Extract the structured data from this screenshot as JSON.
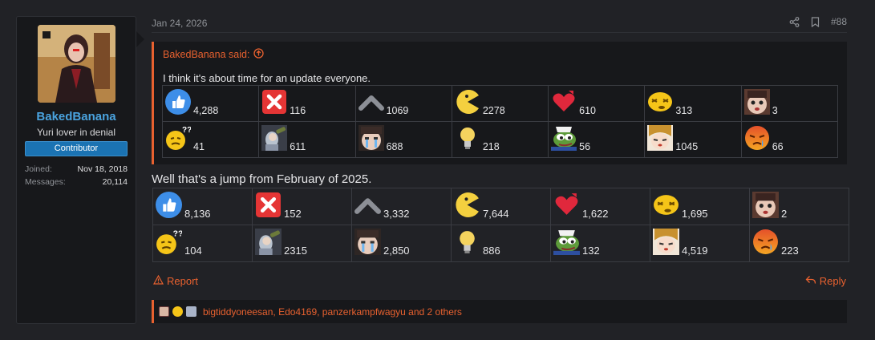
{
  "user": {
    "name": "BakedBanana",
    "title": "Yuri lover in denial",
    "banner": "Contributor",
    "joined_label": "Joined:",
    "joined_value": "Nov 18, 2018",
    "messages_label": "Messages:",
    "messages_value": "20,114"
  },
  "post": {
    "date": "Jan 24, 2026",
    "number": "#88",
    "quote_author": "BakedBanana said:",
    "quote_text": "I think it's about time for an update everyone.",
    "body": "Well that's a jump from February of 2025.",
    "report": "Report",
    "reply": "Reply",
    "likes_text": "bigtiddyoneesan, Edo4169, panzerkampfwagyu and 2 others"
  },
  "quote_reactions": [
    [
      {
        "icon": "like-icon",
        "count": "4,288"
      },
      {
        "icon": "red-x-icon",
        "count": "116"
      },
      {
        "icon": "chevron-up-icon",
        "count": "1069"
      },
      {
        "icon": "pacman-icon",
        "count": "2278"
      },
      {
        "icon": "heart-icon",
        "count": "610"
      },
      {
        "icon": "dizzy-face-icon",
        "count": "313"
      },
      {
        "icon": "anime-face-icon",
        "count": "3"
      }
    ],
    [
      {
        "icon": "confused-face-icon",
        "count": "41"
      },
      {
        "icon": "anime-telescope-icon",
        "count": "611"
      },
      {
        "icon": "anime-crying-icon",
        "count": "688"
      },
      {
        "icon": "lightbulb-icon",
        "count": "218"
      },
      {
        "icon": "pepe-icon",
        "count": "56"
      },
      {
        "icon": "anime-girl-icon",
        "count": "1045"
      },
      {
        "icon": "angry-crying-face-icon",
        "count": "66"
      }
    ]
  ],
  "body_reactions": [
    [
      {
        "icon": "like-icon",
        "count": "8,136"
      },
      {
        "icon": "red-x-icon",
        "count": "152"
      },
      {
        "icon": "chevron-up-icon",
        "count": "3,332"
      },
      {
        "icon": "pacman-icon",
        "count": "7,644"
      },
      {
        "icon": "heart-icon",
        "count": "1,622"
      },
      {
        "icon": "dizzy-face-icon",
        "count": "1,695"
      },
      {
        "icon": "anime-face-icon",
        "count": "2"
      }
    ],
    [
      {
        "icon": "confused-face-icon",
        "count": "104"
      },
      {
        "icon": "anime-telescope-icon",
        "count": "2315"
      },
      {
        "icon": "anime-crying-icon",
        "count": "2,850"
      },
      {
        "icon": "lightbulb-icon",
        "count": "886"
      },
      {
        "icon": "pepe-icon",
        "count": "132"
      },
      {
        "icon": "anime-girl-icon",
        "count": "4,519"
      },
      {
        "icon": "angry-crying-face-icon",
        "count": "223"
      }
    ]
  ],
  "colors": {
    "accent": "#e8612f",
    "username": "#4aa3df",
    "banner": "#1b73b3",
    "background": "#212226",
    "panel": "#17181b"
  }
}
